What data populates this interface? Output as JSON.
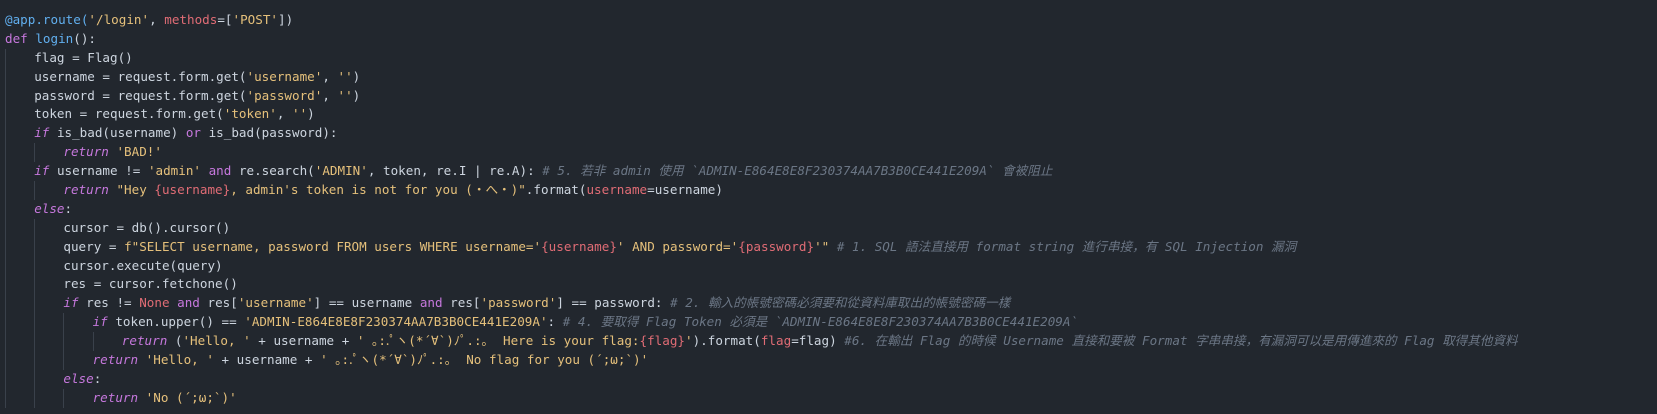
{
  "editor": {
    "lines": [
      {
        "indent": 0,
        "tokens": [
          {
            "t": "dec",
            "v": "@app.route("
          },
          {
            "t": "str",
            "v": "'/login'"
          },
          {
            "t": "plain",
            "v": ", "
          },
          {
            "t": "kwarg",
            "v": "methods"
          },
          {
            "t": "plain",
            "v": "=["
          },
          {
            "t": "str",
            "v": "'POST'"
          },
          {
            "t": "plain",
            "v": "])"
          }
        ]
      },
      {
        "indent": 0,
        "tokens": [
          {
            "t": "kw",
            "v": "def "
          },
          {
            "t": "fn",
            "v": "login"
          },
          {
            "t": "plain",
            "v": "():"
          }
        ]
      },
      {
        "indent": 1,
        "tokens": [
          {
            "t": "plain",
            "v": "flag = Flag()"
          }
        ]
      },
      {
        "indent": 1,
        "tokens": [
          {
            "t": "plain",
            "v": "username = request.form.get("
          },
          {
            "t": "str",
            "v": "'username'"
          },
          {
            "t": "plain",
            "v": ", "
          },
          {
            "t": "str",
            "v": "''"
          },
          {
            "t": "plain",
            "v": ")"
          }
        ]
      },
      {
        "indent": 1,
        "tokens": [
          {
            "t": "plain",
            "v": "password = request.form.get("
          },
          {
            "t": "str",
            "v": "'password'"
          },
          {
            "t": "plain",
            "v": ", "
          },
          {
            "t": "str",
            "v": "''"
          },
          {
            "t": "plain",
            "v": ")"
          }
        ]
      },
      {
        "indent": 1,
        "tokens": [
          {
            "t": "plain",
            "v": "token = request.form.get("
          },
          {
            "t": "str",
            "v": "'token'"
          },
          {
            "t": "plain",
            "v": ", "
          },
          {
            "t": "str",
            "v": "''"
          },
          {
            "t": "plain",
            "v": ")"
          }
        ]
      },
      {
        "indent": 1,
        "tokens": [
          {
            "t": "kwi",
            "v": "if "
          },
          {
            "t": "plain",
            "v": "is_bad(username) "
          },
          {
            "t": "kw",
            "v": "or "
          },
          {
            "t": "plain",
            "v": "is_bad(password):"
          }
        ]
      },
      {
        "indent": 2,
        "tokens": [
          {
            "t": "kwi",
            "v": "return "
          },
          {
            "t": "str",
            "v": "'BAD!'"
          }
        ]
      },
      {
        "indent": 1,
        "tokens": [
          {
            "t": "kwi",
            "v": "if "
          },
          {
            "t": "plain",
            "v": "username != "
          },
          {
            "t": "str",
            "v": "'admin'"
          },
          {
            "t": "kw",
            "v": " and "
          },
          {
            "t": "plain",
            "v": "re.search("
          },
          {
            "t": "str",
            "v": "'ADMIN'"
          },
          {
            "t": "plain",
            "v": ", token, re.I | re.A): "
          },
          {
            "t": "cmt",
            "v": "# 5. 若非 admin 使用 `ADMIN-E864E8E8F230374AA7B3B0CE441E209A` 會被阻止"
          }
        ]
      },
      {
        "indent": 2,
        "tokens": [
          {
            "t": "kwi",
            "v": "return "
          },
          {
            "t": "str",
            "v": "\"Hey "
          },
          {
            "t": "interp",
            "v": "{username}"
          },
          {
            "t": "str",
            "v": ", admin's token is not for you (・へ・)\""
          },
          {
            "t": "plain",
            "v": ".format("
          },
          {
            "t": "kwarg",
            "v": "username"
          },
          {
            "t": "plain",
            "v": "=username)"
          }
        ]
      },
      {
        "indent": 1,
        "tokens": [
          {
            "t": "kwi",
            "v": "else"
          },
          {
            "t": "plain",
            "v": ":"
          }
        ]
      },
      {
        "indent": 2,
        "tokens": [
          {
            "t": "plain",
            "v": "cursor = db().cursor()"
          }
        ]
      },
      {
        "indent": 2,
        "tokens": [
          {
            "t": "plain",
            "v": "query = "
          },
          {
            "t": "str",
            "v": "f\"SELECT username, password FROM users WHERE username='"
          },
          {
            "t": "interp",
            "v": "{username}"
          },
          {
            "t": "str",
            "v": "' AND password='"
          },
          {
            "t": "interp",
            "v": "{password}"
          },
          {
            "t": "str",
            "v": "'\""
          },
          {
            "t": "cmt",
            "v": " # 1. SQL 語法直接用 format string 進行串接，有 SQL Injection 漏洞"
          }
        ]
      },
      {
        "indent": 2,
        "tokens": [
          {
            "t": "plain",
            "v": "cursor.execute(query)"
          }
        ]
      },
      {
        "indent": 2,
        "tokens": [
          {
            "t": "plain",
            "v": "res = cursor.fetchone()"
          }
        ]
      },
      {
        "indent": 2,
        "tokens": [
          {
            "t": "kwi",
            "v": "if "
          },
          {
            "t": "plain",
            "v": "res != "
          },
          {
            "t": "const",
            "v": "None"
          },
          {
            "t": "kw",
            "v": " and "
          },
          {
            "t": "plain",
            "v": "res["
          },
          {
            "t": "str",
            "v": "'username'"
          },
          {
            "t": "plain",
            "v": "] == username "
          },
          {
            "t": "kw",
            "v": "and "
          },
          {
            "t": "plain",
            "v": "res["
          },
          {
            "t": "str",
            "v": "'password'"
          },
          {
            "t": "plain",
            "v": "] == password: "
          },
          {
            "t": "cmt",
            "v": "# 2. 輸入的帳號密碼必須要和從資料庫取出的帳號密碼一樣"
          }
        ]
      },
      {
        "indent": 3,
        "tokens": [
          {
            "t": "kwi",
            "v": "if "
          },
          {
            "t": "plain",
            "v": "token.upper() == "
          },
          {
            "t": "str",
            "v": "'ADMIN-E864E8E8F230374AA7B3B0CE441E209A'"
          },
          {
            "t": "plain",
            "v": ": "
          },
          {
            "t": "cmt",
            "v": "# 4. 要取得 Flag Token 必須是 `ADMIN-E864E8E8F230374AA7B3B0CE441E209A`"
          }
        ]
      },
      {
        "indent": 4,
        "tokens": [
          {
            "t": "kwi",
            "v": "return "
          },
          {
            "t": "plain",
            "v": "("
          },
          {
            "t": "str",
            "v": "'Hello, '"
          },
          {
            "t": "plain",
            "v": " + username + "
          },
          {
            "t": "str",
            "v": "' ｡:.ﾟヽ(*´∀`)ﾉﾟ.:｡  Here is your flag:"
          },
          {
            "t": "interp",
            "v": "{flag}"
          },
          {
            "t": "str",
            "v": "'"
          },
          {
            "t": "plain",
            "v": ").format("
          },
          {
            "t": "kwarg",
            "v": "flag"
          },
          {
            "t": "plain",
            "v": "=flag) "
          },
          {
            "t": "cmt",
            "v": "#6. 在輸出 Flag 的時候 Username 直接和要被 Format 字串串接，有漏洞可以是用傳進來的 Flag 取得其他資料"
          }
        ]
      },
      {
        "indent": 3,
        "tokens": [
          {
            "t": "kwi",
            "v": "return "
          },
          {
            "t": "str",
            "v": "'Hello, '"
          },
          {
            "t": "plain",
            "v": " + username + "
          },
          {
            "t": "str",
            "v": "' ｡:.ﾟヽ(*´∀`)ﾉﾟ.:｡  No flag for you (´;ω;`)'"
          }
        ]
      },
      {
        "indent": 2,
        "tokens": [
          {
            "t": "kwi",
            "v": "else"
          },
          {
            "t": "plain",
            "v": ":"
          }
        ]
      },
      {
        "indent": 3,
        "tokens": [
          {
            "t": "kwi",
            "v": "return "
          },
          {
            "t": "str",
            "v": "'No (´;ω;`)'"
          }
        ]
      }
    ]
  },
  "theme": {
    "background": "#22272e",
    "keyword": "#c678dd",
    "string": "#e5c07b",
    "comment": "#6b7685",
    "function": "#61afef",
    "argument": "#e06c75"
  }
}
